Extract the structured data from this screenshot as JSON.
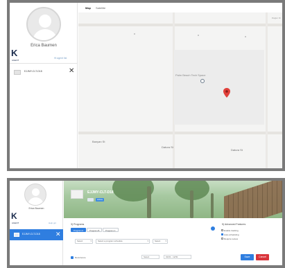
{
  "top_screenshot": {
    "sidebar": {
      "user_name": "Erica Baumen",
      "logo_letter": "K",
      "logo_sub": "AGENT",
      "link": "Hi agent list",
      "item": {
        "label": "EJJMY-CLT-D18"
      }
    },
    "map": {
      "tabs": [
        {
          "label": "Map",
          "active": true
        },
        {
          "label": "Satellite",
          "active": false
        }
      ],
      "place_label": "Palm Beach Tech Space",
      "streets": [
        "Banyan St",
        "Datura St",
        "Datura St"
      ],
      "corner_text": "Flagler Dr"
    }
  },
  "bottom_screenshot": {
    "sidebar": {
      "user_name": "Erica Baumen",
      "logo_letter": "K",
      "logo_sub": "AGENT",
      "link": "Help grc",
      "item": {
        "label": "EJJMY-CLT-D18"
      }
    },
    "banner": {
      "title": "EJJMY-CLT-D18",
      "badge": "Active"
    },
    "programs": {
      "title": "3) Programs",
      "chips": [
        {
          "label": "Program A",
          "active": true
        },
        {
          "label": "Program B",
          "active": false
        },
        {
          "label": "Program C",
          "active": false
        }
      ]
    },
    "advanced": {
      "title": "5) Advanced Features",
      "options": [
        {
          "label": "Enable tracking",
          "checked": false
        },
        {
          "label": "Auto-scheduling",
          "checked": true
        },
        {
          "label": "Require review",
          "checked": false
        }
      ]
    },
    "selects": [
      "Select",
      "Select a program schedule",
      "Select"
    ],
    "footer": {
      "checkbox_label": "Recurrence",
      "select_label": "Select",
      "date_range": "01/01 - 12/31",
      "save": "Save",
      "cancel": "Cancel"
    }
  }
}
